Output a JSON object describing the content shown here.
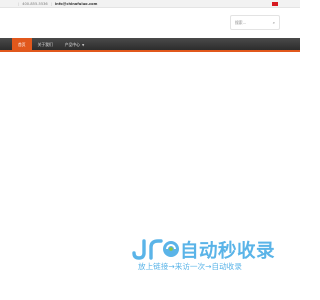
{
  "topbar": {
    "phone": "400-855-5536",
    "email": "info@chinafuluo.com"
  },
  "header": {
    "search_placeholder": "搜索..."
  },
  "nav": {
    "items": [
      {
        "label": "首页",
        "active": true
      },
      {
        "label": "关于我们",
        "active": false
      },
      {
        "label": "产品中心",
        "active": false,
        "has_dropdown": true
      }
    ]
  },
  "watermark": {
    "logo_text": "JR",
    "title": "自动秒收录",
    "subtitle": "放上链接→来访一次→自动收录"
  },
  "colors": {
    "accent": "#e1581c",
    "navbar": "#333333",
    "watermark": "#5ab4e8",
    "flag": "#d71920"
  },
  "icons": {
    "search": "search-icon",
    "dropdown": "chevron-down-icon",
    "flag": "flag-icon"
  }
}
